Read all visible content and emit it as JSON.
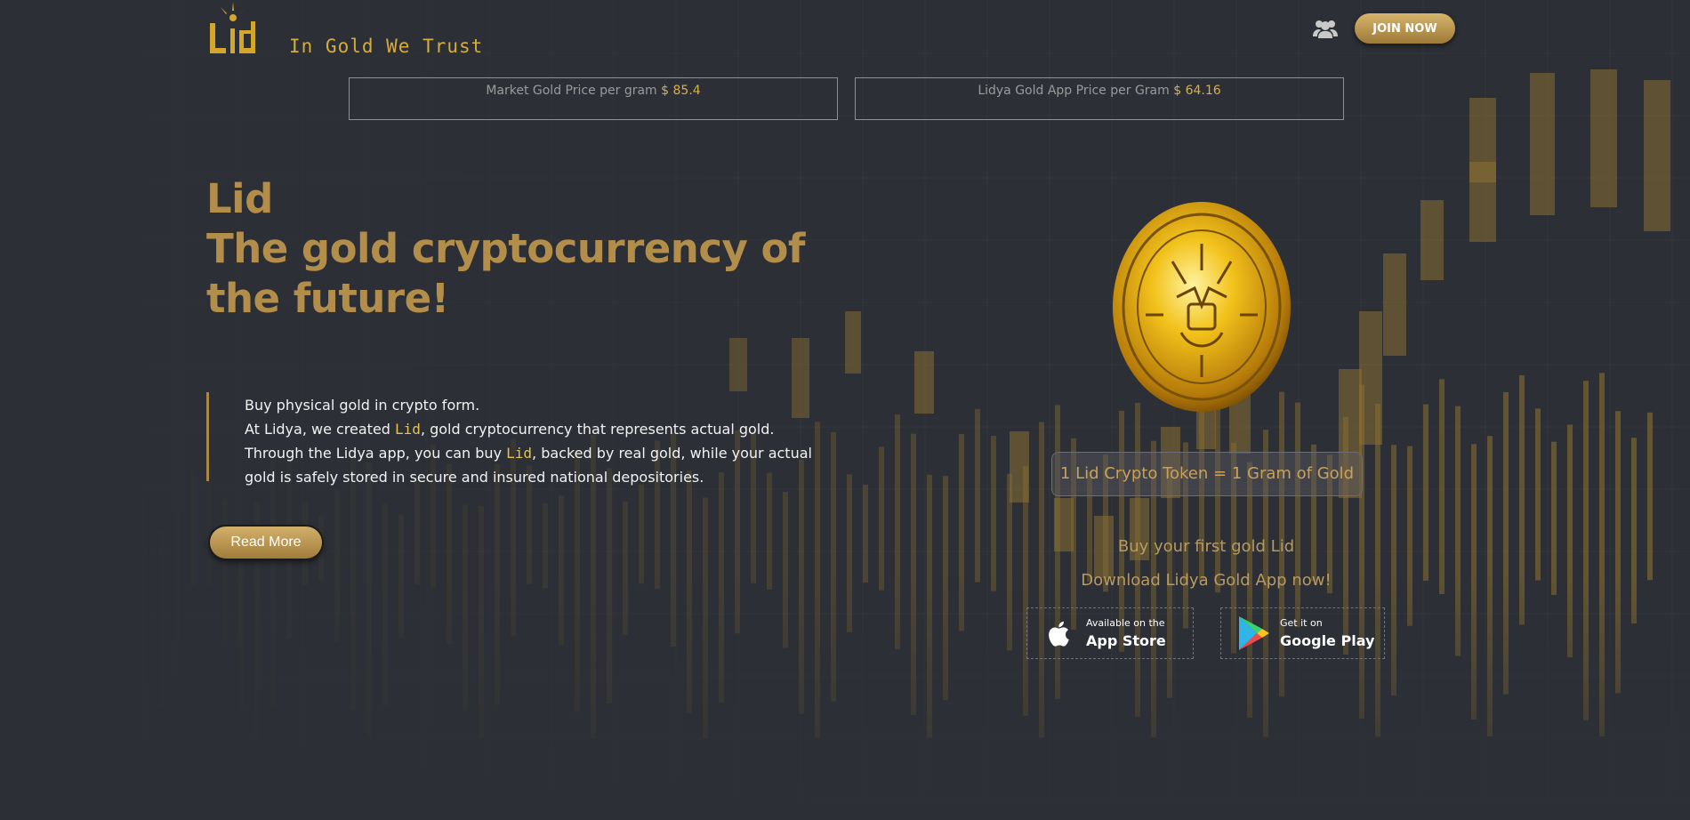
{
  "header": {
    "logo_text": "Lid",
    "tagline": "In Gold We Trust",
    "join_label": "JOIN NOW",
    "users_icon": "users-icon"
  },
  "prices": {
    "market_label": "Market Gold Price per gram",
    "market_value": "$ 85.4",
    "app_label": "Lidya Gold App Price per Gram",
    "app_value": "$ 64.16"
  },
  "hero": {
    "title_line1": "Lid",
    "title_line2": "The gold cryptocurrency of",
    "title_line3": "the future!",
    "para1": "Buy physical gold in crypto form.",
    "para2_pre": "At Lidya, we created ",
    "para2_lid": "Lid",
    "para2_post": ", gold cryptocurrency that represents actual gold.",
    "para3_pre": "Through the Lidya app, you can buy ",
    "para3_lid": "Lid",
    "para3_post": ", backed by real gold, while your actual gold is safely stored in secure and insured national depositories.",
    "read_more": "Read More"
  },
  "token": {
    "equation": "1 Lid Crypto Token = 1 Gram of Gold",
    "buy_first": "Buy your first gold Lid",
    "download": "Download Lidya Gold App now!"
  },
  "stores": {
    "appstore_small": "Available on the",
    "appstore_big": "App Store",
    "appstore_icon": "apple-icon",
    "gplay_small": "Get it on",
    "gplay_big": "Google Play",
    "gplay_icon": "google-play-icon"
  },
  "colors": {
    "background": "#2c2f35",
    "gold_accent": "#b38e4b",
    "gold_bright": "#d6b04e",
    "text_light": "#f2f2f2"
  }
}
